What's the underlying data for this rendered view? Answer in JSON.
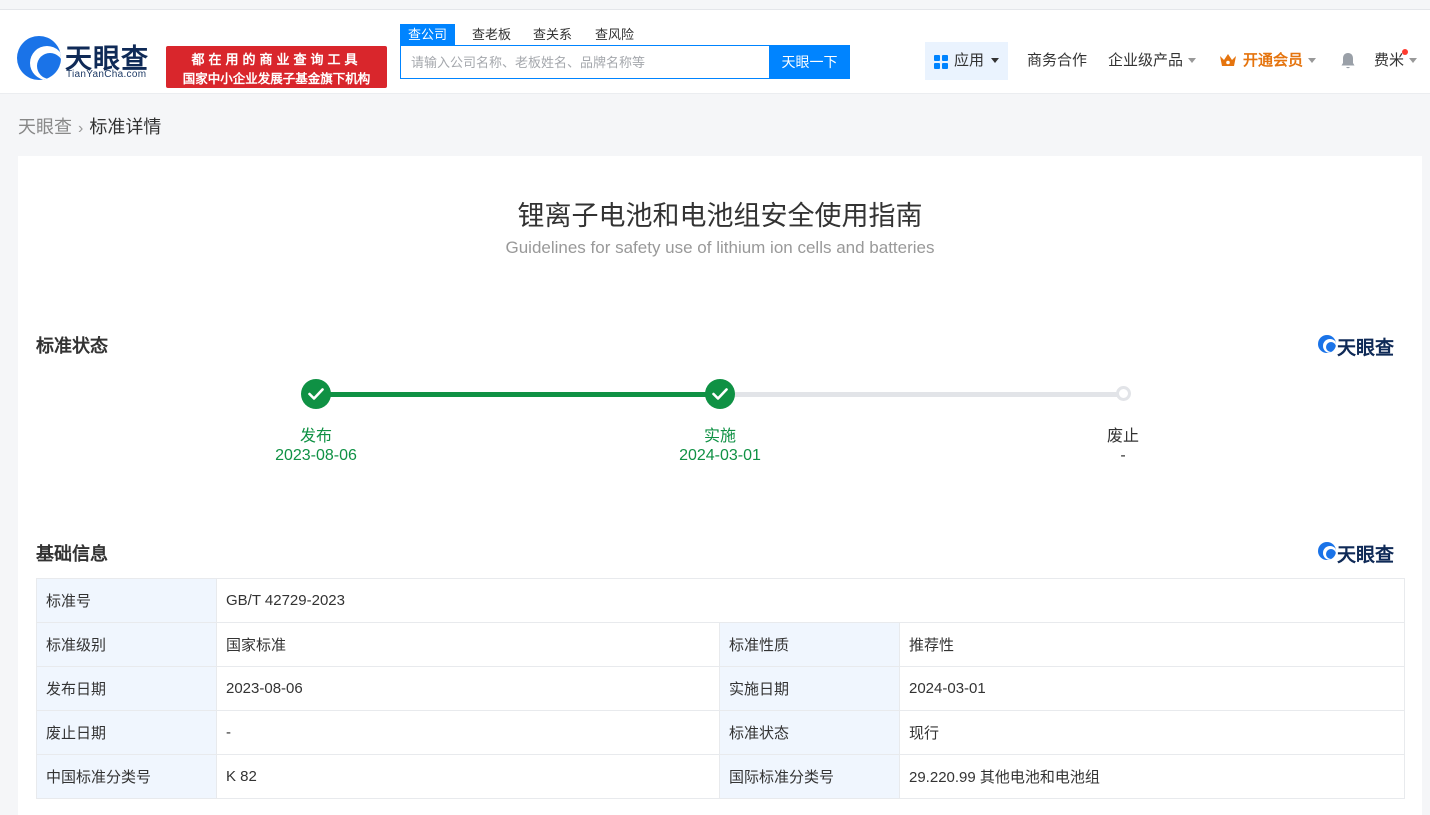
{
  "header": {
    "logo_text": "天眼查",
    "logo_sub": "TianYanCha.com",
    "slogan_line1": "都在用的商业查询工具",
    "slogan_line2": "国家中小企业发展子基金旗下机构",
    "search_tabs": [
      "查公司",
      "查老板",
      "查关系",
      "查风险"
    ],
    "search_placeholder": "请输入公司名称、老板姓名、品牌名称等",
    "search_button": "天眼一下",
    "nav": {
      "app": "应用",
      "business": "商务合作",
      "enterprise": "企业级产品",
      "vip": "开通会员",
      "user": "费米"
    }
  },
  "breadcrumb": {
    "home": "天眼查",
    "current": "标准详情"
  },
  "standard": {
    "title_cn": "锂离子电池和电池组安全使用指南",
    "title_en": "Guidelines for safety use of lithium ion cells and batteries"
  },
  "status_section": {
    "title": "标准状态",
    "brand": "天眼查",
    "steps": [
      {
        "label": "发布",
        "date": "2023-08-06"
      },
      {
        "label": "实施",
        "date": "2024-03-01"
      },
      {
        "label": "废止",
        "date": "-"
      }
    ],
    "progress_steps_completed": 2
  },
  "info_section": {
    "title": "基础信息",
    "brand": "天眼查",
    "standard_no_label": "标准号",
    "standard_no": "GB/T 42729-2023",
    "rows": [
      {
        "l1": "标准级别",
        "v1": "国家标准",
        "l2": "标准性质",
        "v2": "推荐性"
      },
      {
        "l1": "发布日期",
        "v1": "2023-08-06",
        "l2": "实施日期",
        "v2": "2024-03-01"
      },
      {
        "l1": "废止日期",
        "v1": "-",
        "l2": "标准状态",
        "v2": "现行"
      },
      {
        "l1": "中国标准分类号",
        "v1": "K 82",
        "l2": "国际标准分类号",
        "v2": "29.220.99 其他电池和电池组"
      }
    ]
  },
  "colors": {
    "primary": "#0084ff",
    "success": "#0f9144",
    "slogan_bg": "#d9262c",
    "vip": "#e5740e"
  }
}
